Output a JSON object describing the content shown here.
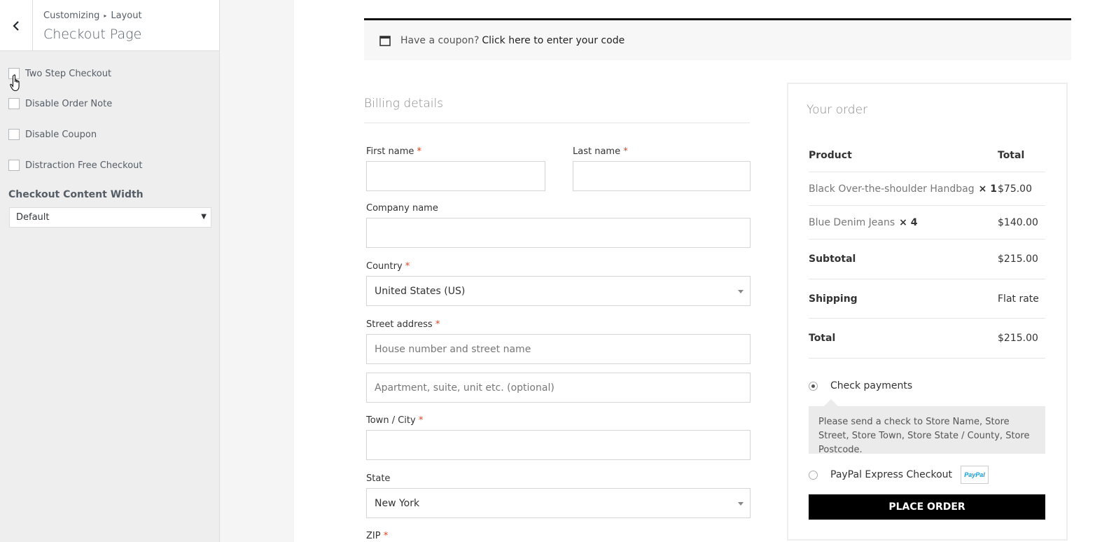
{
  "customizer": {
    "breadcrumb": [
      "Customizing",
      "Layout"
    ],
    "title": "Checkout Page",
    "options": [
      {
        "label": "Two Step Checkout",
        "checked": false
      },
      {
        "label": "Disable Order Note",
        "checked": false
      },
      {
        "label": "Disable Coupon",
        "checked": false
      },
      {
        "label": "Distraction Free Checkout",
        "checked": false
      }
    ],
    "width_label": "Checkout Content Width",
    "width_value": "Default"
  },
  "coupon": {
    "prompt": "Have a coupon?",
    "link": "Click here to enter your code"
  },
  "billing": {
    "title": "Billing details",
    "first_name_label": "First name",
    "last_name_label": "Last name",
    "company_label": "Company name",
    "country_label": "Country",
    "country_value": "United States (US)",
    "street_label": "Street address",
    "street_placeholder": "House number and street name",
    "street2_placeholder": "Apartment, suite, unit etc. (optional)",
    "city_label": "Town / City",
    "state_label": "State",
    "state_value": "New York",
    "zip_label": "ZIP",
    "required_mark": "*"
  },
  "order": {
    "title": "Your order",
    "col_product": "Product",
    "col_total": "Total",
    "items": [
      {
        "name": "Black Over-the-shoulder Handbag",
        "qty": "× 1",
        "total": "$75.00"
      },
      {
        "name": "Blue Denim Jeans",
        "qty": "× 4",
        "total": "$140.00"
      }
    ],
    "subtotal_label": "Subtotal",
    "subtotal_value": "$215.00",
    "shipping_label": "Shipping",
    "shipping_value": "Flat rate",
    "total_label": "Total",
    "total_value": "$215.00",
    "payment_check_label": "Check payments",
    "payment_check_desc": "Please send a check to Store Name, Store Street, Store Town, Store State / County, Store Postcode.",
    "payment_paypal_label": "PayPal Express Checkout",
    "paypal_badge": "PayPal",
    "place_order": "PLACE ORDER"
  }
}
